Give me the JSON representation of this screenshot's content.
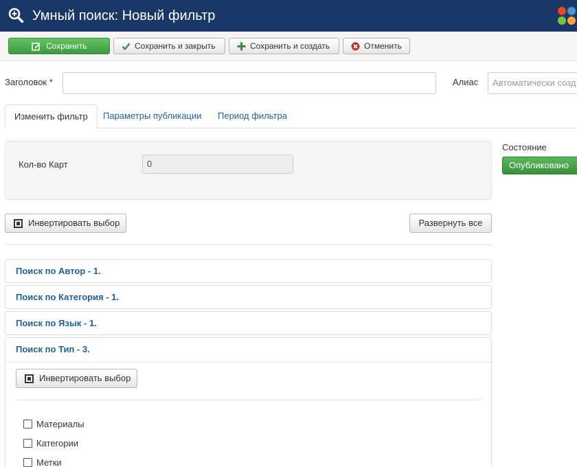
{
  "header": {
    "title": "Умный поиск: Новый фильтр",
    "icon": "search-icon",
    "logo": "joomla-logo"
  },
  "toolbar": {
    "save": "Сохранить",
    "save_close": "Сохранить и закрыть",
    "save_new": "Сохранить и создать",
    "cancel": "Отменить"
  },
  "form": {
    "title_label": "Заголовок *",
    "title_value": "",
    "alias_label": "Алиас",
    "alias_placeholder": "Автоматически созд"
  },
  "tabs": [
    {
      "label": "Изменить фильтр",
      "active": true
    },
    {
      "label": "Параметры публикации",
      "active": false
    },
    {
      "label": "Период фильтра",
      "active": false
    }
  ],
  "map_count": {
    "label": "Кол-во Карт",
    "value": "0"
  },
  "actions": {
    "invert": "Инвертировать выбор",
    "expand": "Развернуть все"
  },
  "accordion": [
    {
      "title": "Поиск по Автор - 1."
    },
    {
      "title": "Поиск по Категория - 1."
    },
    {
      "title": "Поиск по Язык - 1."
    },
    {
      "title": "Поиск по Тип - 3."
    }
  ],
  "type_section": {
    "invert": "Инвертировать выбор",
    "items": [
      {
        "label": "Материалы",
        "checked": false
      },
      {
        "label": "Категории",
        "checked": false
      },
      {
        "label": "Метки",
        "checked": false
      }
    ]
  },
  "sidebar": {
    "status_label": "Состояние",
    "status_value": "Опубликовано"
  },
  "colors": {
    "header_bg": "#1a3867",
    "success": "#4cae4c",
    "link": "#1f5f9e"
  }
}
